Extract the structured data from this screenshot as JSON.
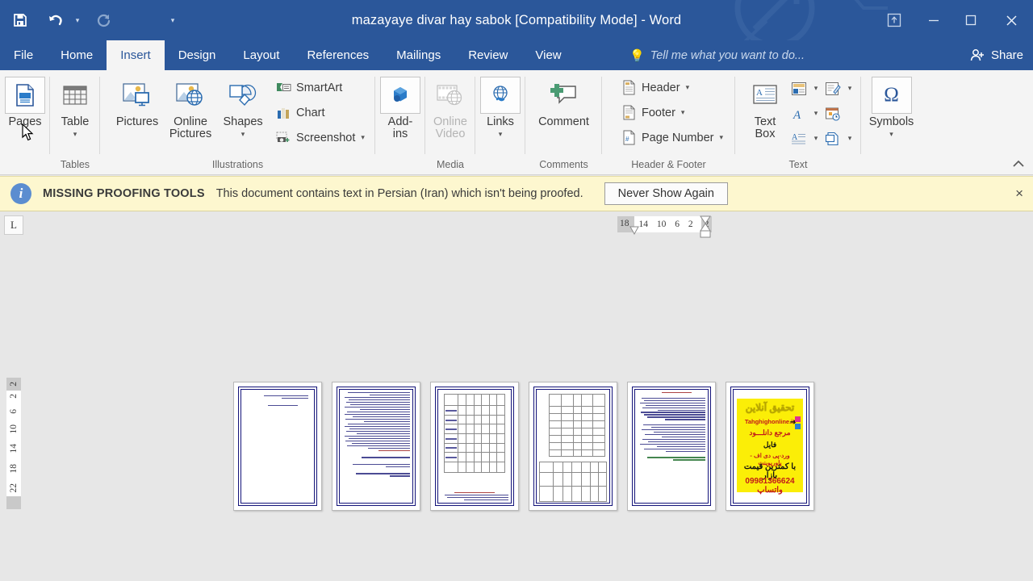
{
  "window": {
    "title": "mazayaye divar hay sabok [Compatibility Mode] - Word",
    "quick_access": [
      {
        "name": "save-icon",
        "label": "Save"
      },
      {
        "name": "undo-icon",
        "label": "Undo"
      },
      {
        "name": "redo-icon",
        "label": "Redo"
      },
      {
        "name": "customize-qat-icon",
        "label": "Customize Quick Access Toolbar"
      }
    ],
    "controls": [
      {
        "name": "ribbon-display-options",
        "label": "Ribbon Display Options"
      },
      {
        "name": "minimize",
        "label": "–"
      },
      {
        "name": "restore",
        "label": "❐"
      },
      {
        "name": "close",
        "label": "×"
      }
    ]
  },
  "tabs": [
    {
      "label": "File",
      "active": false
    },
    {
      "label": "Home",
      "active": false
    },
    {
      "label": "Insert",
      "active": true
    },
    {
      "label": "Design",
      "active": false
    },
    {
      "label": "Layout",
      "active": false
    },
    {
      "label": "References",
      "active": false
    },
    {
      "label": "Mailings",
      "active": false
    },
    {
      "label": "Review",
      "active": false
    },
    {
      "label": "View",
      "active": false
    }
  ],
  "tellme": {
    "placeholder": "Tell me what you want to do..."
  },
  "share": {
    "label": "Share"
  },
  "ribbon": {
    "collapse_label": "Collapse the Ribbon",
    "groups": [
      {
        "id": "pages",
        "label": "",
        "buttons": [
          {
            "label": "Pages",
            "caret": "▾"
          }
        ]
      },
      {
        "id": "tables",
        "label": "Tables",
        "buttons": [
          {
            "label": "Table",
            "caret": "▾"
          }
        ]
      },
      {
        "id": "illustrations",
        "label": "Illustrations",
        "buttons": [
          {
            "label": "Pictures",
            "caret": ""
          },
          {
            "label": "Online\nPictures",
            "caret": ""
          },
          {
            "label": "Shapes",
            "caret": "▾"
          }
        ],
        "small_buttons": [
          {
            "label": "SmartArt",
            "caret": ""
          },
          {
            "label": "Chart",
            "caret": ""
          },
          {
            "label": "Screenshot",
            "caret": "▾"
          }
        ]
      },
      {
        "id": "addins",
        "label": "",
        "buttons": [
          {
            "label": "Add-\nins",
            "caret": "▾",
            "inline_caret": true
          }
        ]
      },
      {
        "id": "media",
        "label": "Media",
        "buttons": [
          {
            "label": "Online\nVideo",
            "caret": "",
            "disabled": true
          }
        ]
      },
      {
        "id": "links",
        "label": "",
        "buttons": [
          {
            "label": "Links",
            "caret": "▾"
          }
        ]
      },
      {
        "id": "comments",
        "label": "Comments",
        "buttons": [
          {
            "label": "Comment",
            "caret": ""
          }
        ]
      },
      {
        "id": "header-footer",
        "label": "Header & Footer",
        "small_buttons": [
          {
            "label": "Header",
            "caret": "▾"
          },
          {
            "label": "Footer",
            "caret": "▾"
          },
          {
            "label": "Page Number",
            "caret": "▾"
          }
        ]
      },
      {
        "id": "text",
        "label": "Text",
        "buttons": [
          {
            "label": "Text\nBox",
            "caret": "▾",
            "inline_caret": true
          }
        ]
      },
      {
        "id": "symbols",
        "label": "",
        "buttons": [
          {
            "label": "Symbols",
            "caret": "▾"
          }
        ]
      }
    ]
  },
  "message_bar": {
    "icon": "info-icon",
    "title": "MISSING PROOFING TOOLS",
    "text": "This document contains text in Persian (Iran) which isn't being proofed.",
    "button": "Never Show Again",
    "close": "×",
    "background": "#fdf7cf"
  },
  "ruler": {
    "tab_selector": "L",
    "horizontal": [
      "18",
      "14",
      "10",
      "6",
      "2",
      "2"
    ],
    "vertical": [
      "2",
      "2",
      "6",
      "10",
      "14",
      "18",
      "22"
    ]
  },
  "document": {
    "page_count": 6,
    "pages": [
      {
        "index": 1,
        "type": "title",
        "bordered": true
      },
      {
        "index": 2,
        "type": "text",
        "bordered": true
      },
      {
        "index": 3,
        "type": "table",
        "bordered": true
      },
      {
        "index": 4,
        "type": "table",
        "bordered": true
      },
      {
        "index": 5,
        "type": "text",
        "bordered": true
      },
      {
        "index": 6,
        "type": "advertisement",
        "bordered": true
      }
    ],
    "advertisement": {
      "heading": "تحقیق آنلاین",
      "site": "Tahghighonline.ir",
      "line1": "مرجع دانلـــود",
      "line2": "فایل",
      "line3": "ورد-پی دی اف - پاورپوینت",
      "line4": "با کمترین قیمت بازار",
      "line5": "09981366624 واتساپ",
      "background": "#fbee07"
    }
  },
  "colors": {
    "title_bar": "#2b579a",
    "ribbon_bg": "#f4f4f4",
    "canvas_bg": "#e7e7e7",
    "accent": "#2b579a",
    "message_bar": "#fdf7cf"
  }
}
